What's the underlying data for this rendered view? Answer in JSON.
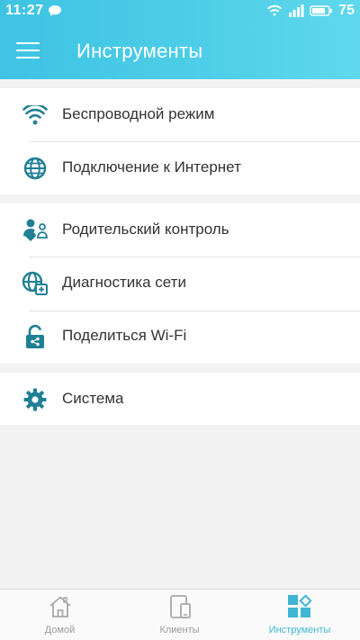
{
  "status_bar": {
    "time": "11:27",
    "battery": "75",
    "icons": [
      "chat-icon",
      "wifi-icon",
      "signal-icon",
      "battery-icon"
    ]
  },
  "app_bar": {
    "title": "Инструменты",
    "menu_icon": "hamburger-menu-icon"
  },
  "groups": [
    {
      "items": [
        {
          "label": "Беспроводной режим",
          "icon": "wifi-icon"
        },
        {
          "label": "Подключение к Интернет",
          "icon": "globe-icon"
        }
      ]
    },
    {
      "items": [
        {
          "label": "Родительский контроль",
          "icon": "parental-control-icon"
        },
        {
          "label": "Диагностика сети",
          "icon": "network-diagnostics-icon"
        },
        {
          "label": "Поделиться Wi-Fi",
          "icon": "share-wifi-lock-icon"
        }
      ]
    },
    {
      "items": [
        {
          "label": "Система",
          "icon": "gear-icon"
        }
      ]
    }
  ],
  "bottom_nav": {
    "items": [
      {
        "label": "Домой",
        "icon": "home-icon",
        "active": false
      },
      {
        "label": "Клиенты",
        "icon": "devices-icon",
        "active": false
      },
      {
        "label": "Инструменты",
        "icon": "tools-grid-icon",
        "active": true
      }
    ]
  },
  "colors": {
    "accent": "#3eb6d4",
    "icon": "#1f7f95",
    "header_start": "#3ec3e3",
    "header_end": "#5fd8ec",
    "nav_inactive": "#9a9a9a"
  }
}
